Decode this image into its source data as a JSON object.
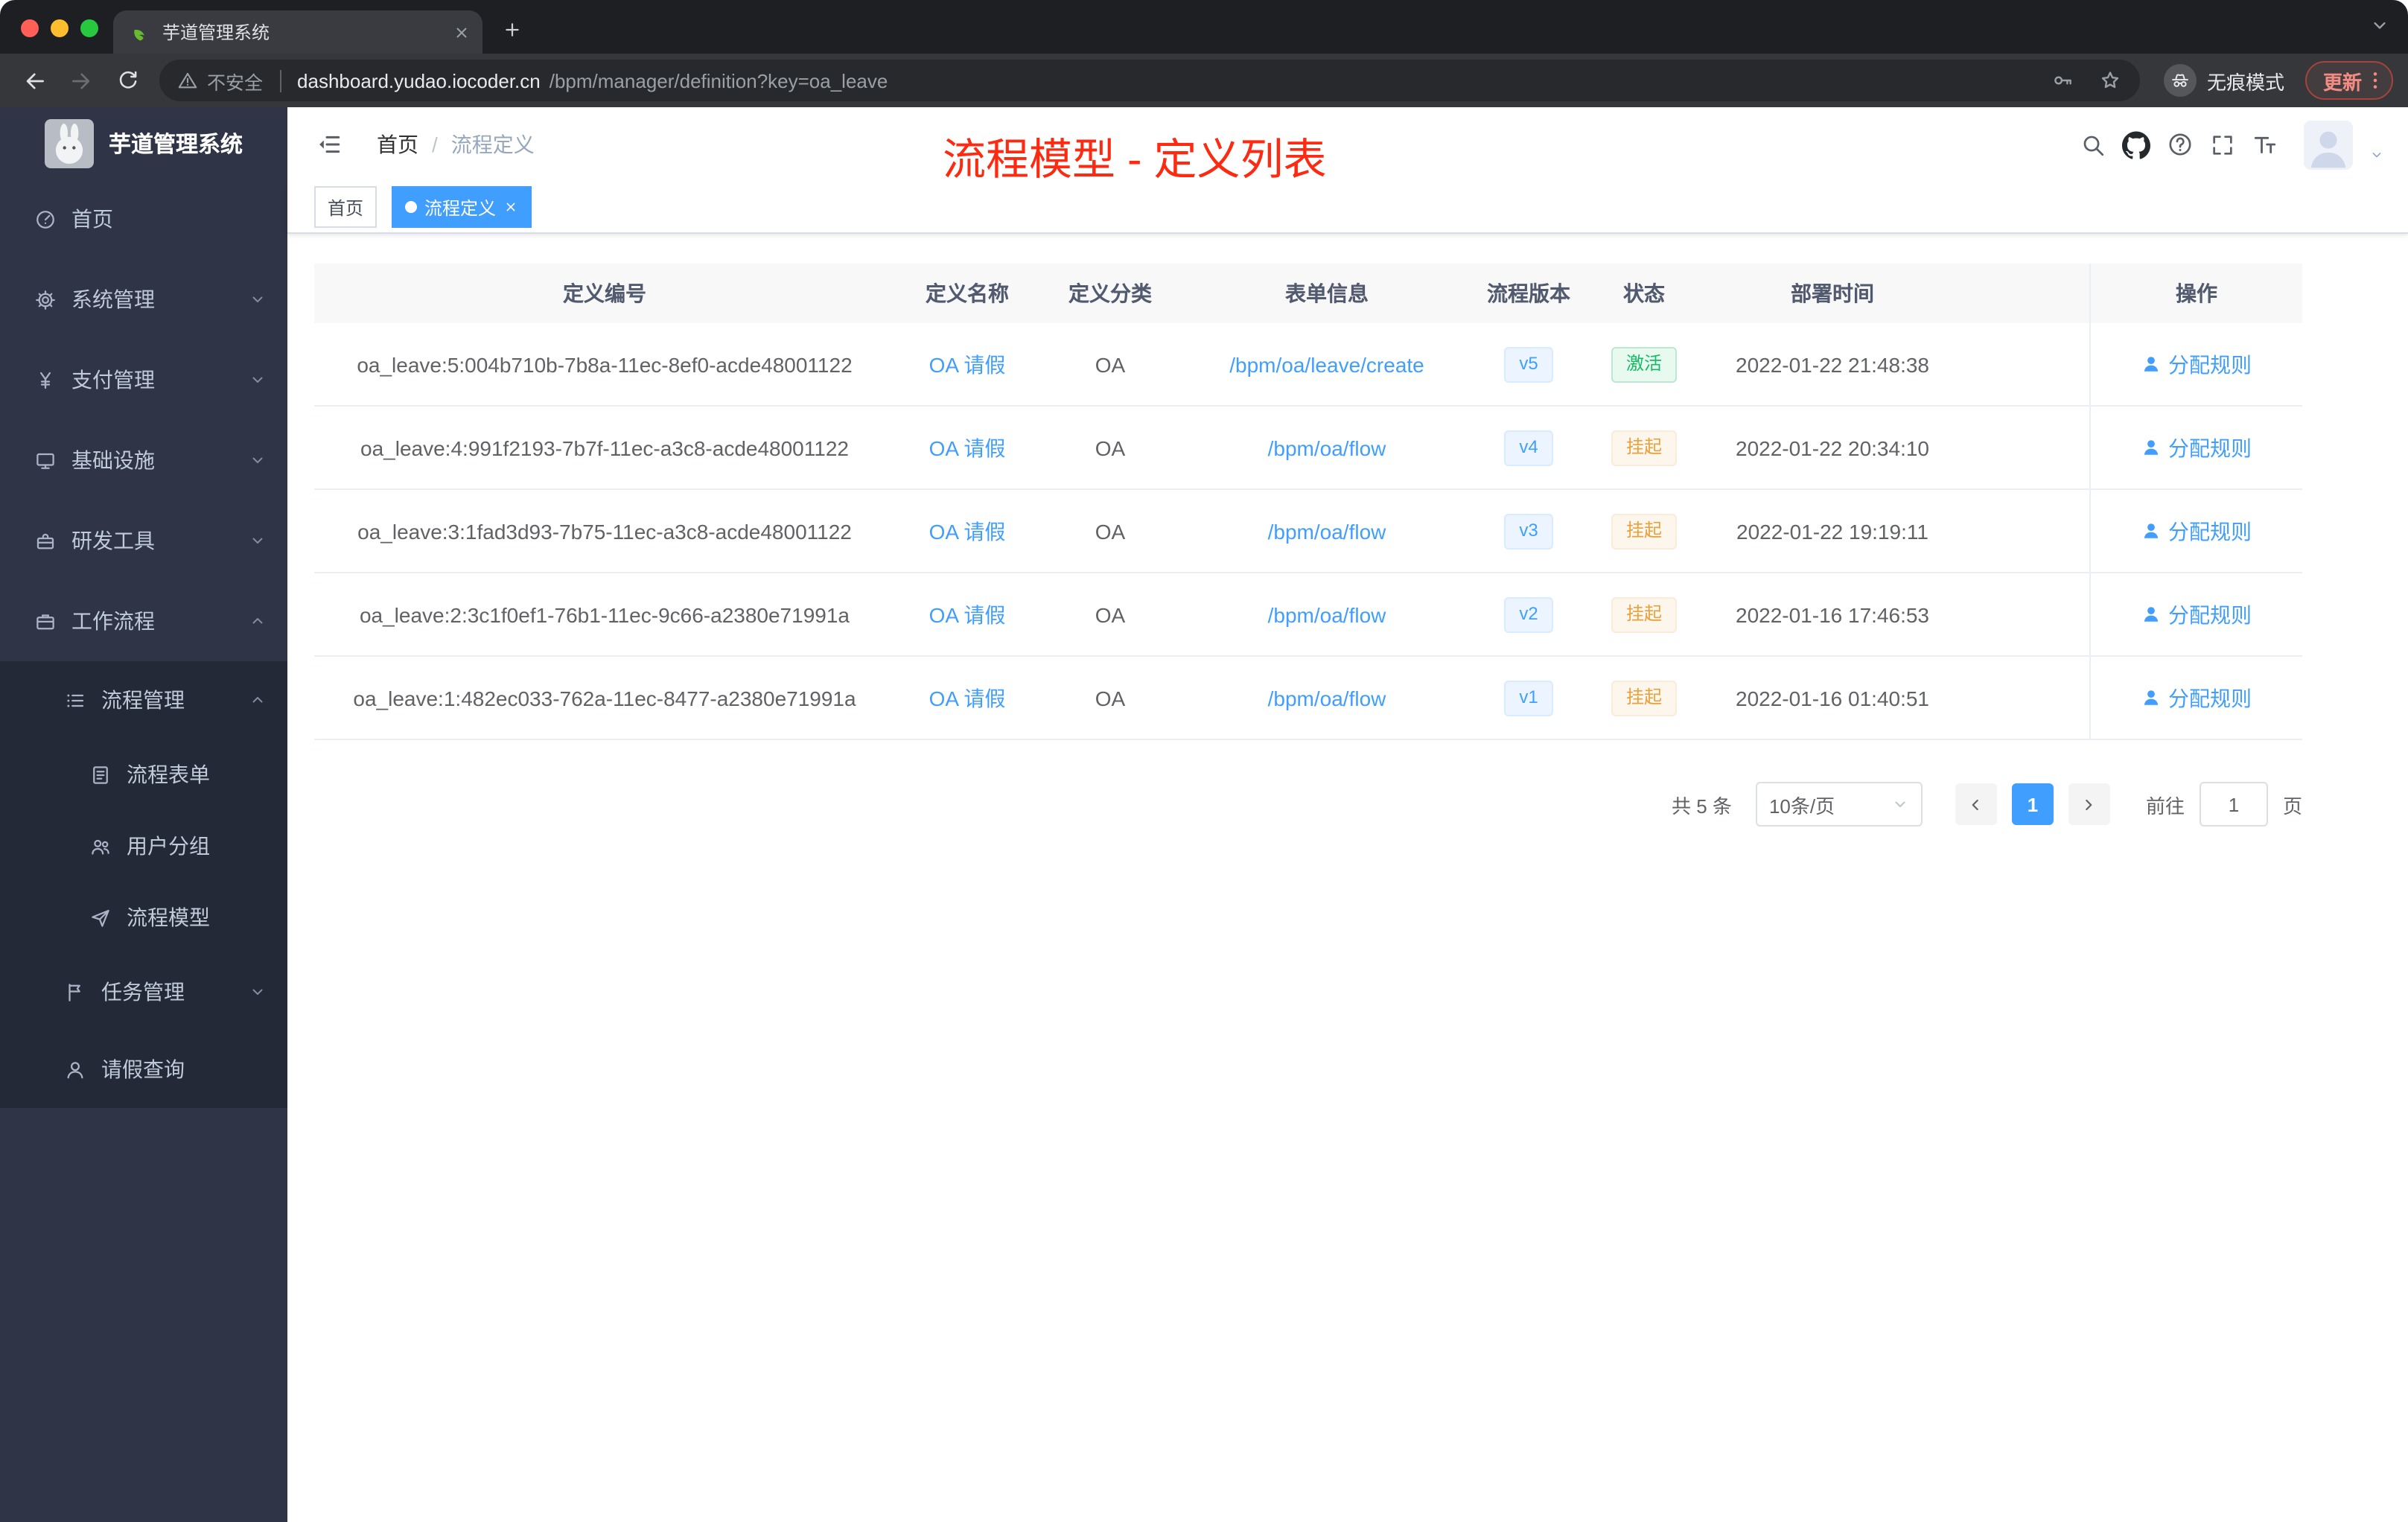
{
  "browser": {
    "tab_title": "芋道管理系统",
    "security_label": "不安全",
    "url_domain": "dashboard.yudao.iocoder.cn",
    "url_path": "/bpm/manager/definition?key=oa_leave",
    "incognito_label": "无痕模式",
    "update_label": "更新"
  },
  "sidebar": {
    "logo_title": "芋道管理系统",
    "items": [
      {
        "key": "home",
        "label": "首页",
        "icon": "dashboard-icon"
      },
      {
        "key": "system",
        "label": "系统管理",
        "icon": "gear-icon",
        "chevron": "down"
      },
      {
        "key": "payment",
        "label": "支付管理",
        "icon": "yen-icon",
        "chevron": "down"
      },
      {
        "key": "infrastructure",
        "label": "基础设施",
        "icon": "monitor-icon",
        "chevron": "down"
      },
      {
        "key": "dev-tools",
        "label": "研发工具",
        "icon": "toolbox-icon",
        "chevron": "down"
      },
      {
        "key": "workflow",
        "label": "工作流程",
        "icon": "briefcase-icon",
        "chevron": "up"
      }
    ],
    "submenu": [
      {
        "key": "process-management",
        "label": "流程管理",
        "icon": "list-icon",
        "chevron": "up",
        "level": 1
      },
      {
        "key": "process-form",
        "label": "流程表单",
        "icon": "form-icon",
        "level": 2
      },
      {
        "key": "user-group",
        "label": "用户分组",
        "icon": "users-icon",
        "level": 2
      },
      {
        "key": "process-model",
        "label": "流程模型",
        "icon": "send-icon",
        "level": 2
      },
      {
        "key": "task-management",
        "label": "任务管理",
        "icon": "tasks-icon",
        "chevron": "down",
        "level": 1
      },
      {
        "key": "leave-query",
        "label": "请假查询",
        "icon": "user-icon",
        "level": 1
      }
    ]
  },
  "header": {
    "breadcrumb": [
      "首页",
      "流程定义"
    ],
    "annotation": "流程模型 - 定义列表",
    "icons": [
      "search-icon",
      "github-icon",
      "question-icon",
      "fullscreen-icon",
      "fontsize-icon"
    ]
  },
  "tags": {
    "items": [
      {
        "label": "首页",
        "active": false
      },
      {
        "label": "流程定义",
        "active": true
      }
    ]
  },
  "table": {
    "columns": [
      "定义编号",
      "定义名称",
      "定义分类",
      "表单信息",
      "流程版本",
      "状态",
      "部署时间",
      "操作"
    ],
    "rows": [
      {
        "id": "oa_leave:5:004b710b-7b8a-11ec-8ef0-acde48001122",
        "name": "OA 请假",
        "category": "OA",
        "form": "/bpm/oa/leave/create",
        "version": "v5",
        "status": "激活",
        "status_type": "success",
        "deploy_time": "2022-01-22 21:48:38",
        "action": "分配规则"
      },
      {
        "id": "oa_leave:4:991f2193-7b7f-11ec-a3c8-acde48001122",
        "name": "OA 请假",
        "category": "OA",
        "form": "/bpm/oa/flow",
        "version": "v4",
        "status": "挂起",
        "status_type": "warning",
        "deploy_time": "2022-01-22 20:34:10",
        "action": "分配规则"
      },
      {
        "id": "oa_leave:3:1fad3d93-7b75-11ec-a3c8-acde48001122",
        "name": "OA 请假",
        "category": "OA",
        "form": "/bpm/oa/flow",
        "version": "v3",
        "status": "挂起",
        "status_type": "warning",
        "deploy_time": "2022-01-22 19:19:11",
        "action": "分配规则"
      },
      {
        "id": "oa_leave:2:3c1f0ef1-76b1-11ec-9c66-a2380e71991a",
        "name": "OA 请假",
        "category": "OA",
        "form": "/bpm/oa/flow",
        "version": "v2",
        "status": "挂起",
        "status_type": "warning",
        "deploy_time": "2022-01-16 17:46:53",
        "action": "分配规则"
      },
      {
        "id": "oa_leave:1:482ec033-762a-11ec-8477-a2380e71991a",
        "name": "OA 请假",
        "category": "OA",
        "form": "/bpm/oa/flow",
        "version": "v1",
        "status": "挂起",
        "status_type": "warning",
        "deploy_time": "2022-01-16 01:40:51",
        "action": "分配规则"
      }
    ]
  },
  "pagination": {
    "total_label": "共 5 条",
    "page_size": "10条/页",
    "current_page": "1",
    "goto_label": "前往",
    "goto_value": "1",
    "page_unit": "页"
  },
  "colors": {
    "primary": "#409eff",
    "success": "#15ba64",
    "warning": "#e6a23c",
    "annotation_red": "#fb2a10",
    "sidebar_bg": "#2f3447",
    "submenu_bg": "#242938"
  }
}
